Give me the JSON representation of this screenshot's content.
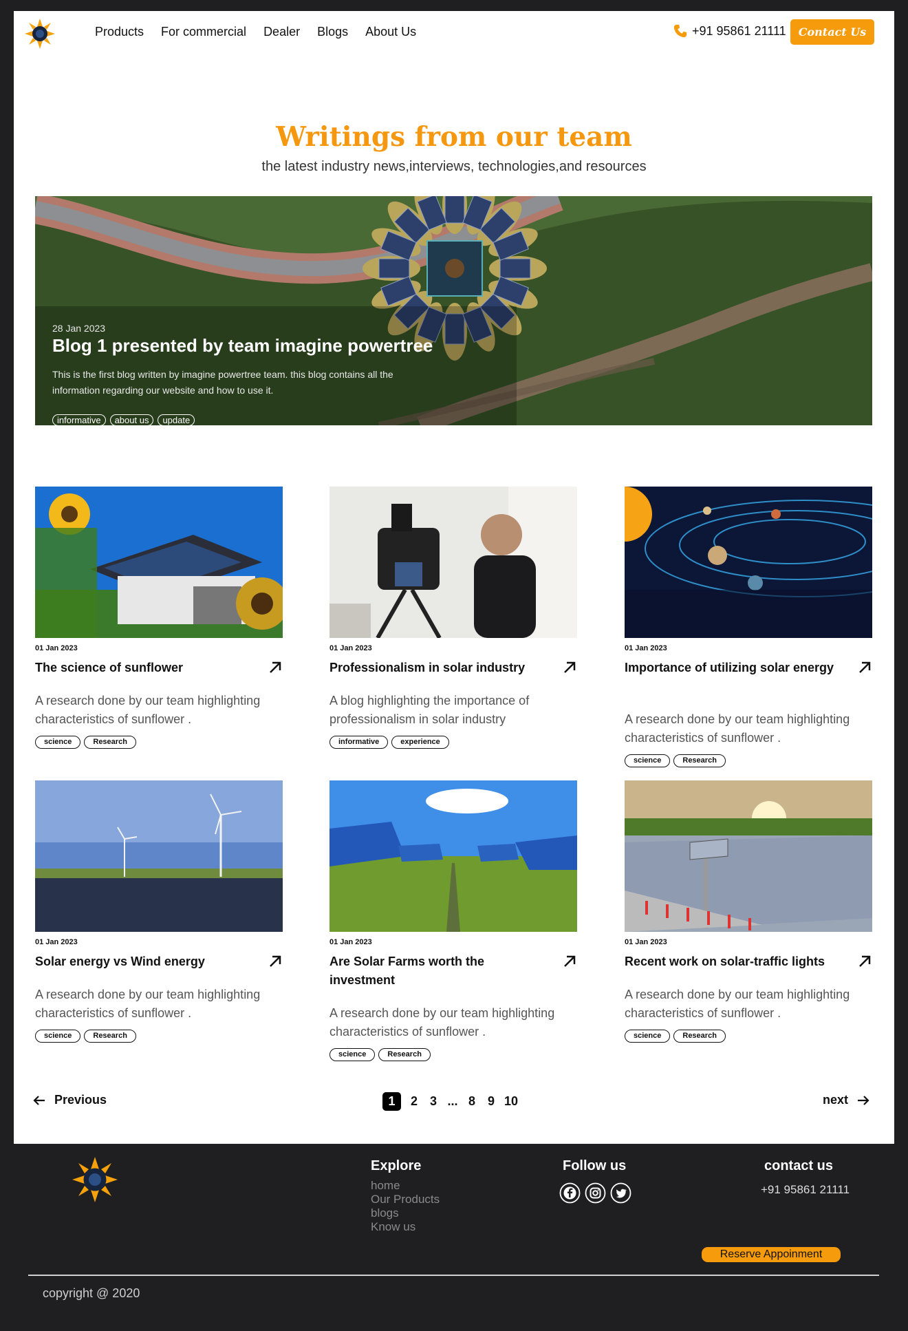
{
  "header": {
    "nav": [
      "Products",
      "For commercial",
      "Dealer",
      "Blogs",
      "About Us"
    ],
    "phone": "+91 95861 21111",
    "contact_label": "Contact Us"
  },
  "intro": {
    "title": "Writings from our team",
    "subtitle": "the latest industry news,interviews, technologies,and resources"
  },
  "featured": {
    "date": "28 Jan 2023",
    "title": "Blog 1 presented by team imagine powertree",
    "description": "This is the first blog written by imagine powertree team. this blog contains all the information regarding our website and how to use it.",
    "tags": [
      "informative",
      "about us",
      "update"
    ]
  },
  "posts": [
    {
      "date": "01 Jan 2023",
      "title": "The science of sunflower",
      "description": "A research done by our team highlighting characteristics of sunflower .",
      "tags": [
        "science",
        "Research"
      ]
    },
    {
      "date": "01 Jan 2023",
      "title": "Professionalism in solar industry",
      "description": "A blog highlighting the importance of professionalism in solar industry",
      "tags": [
        "informative",
        "experience"
      ]
    },
    {
      "date": "01 Jan 2023",
      "title": "Importance of utilizing solar energy",
      "description": "A research done by our team highlighting characteristics of sunflower .",
      "tags": [
        "science",
        "Research"
      ]
    },
    {
      "date": "01 Jan 2023",
      "title": "Solar energy vs Wind energy",
      "description": "A research done by our team highlighting characteristics of sunflower .",
      "tags": [
        "science",
        "Research"
      ]
    },
    {
      "date": "01 Jan 2023",
      "title": "Are Solar Farms worth the investment",
      "description": "A research done by our team highlighting characteristics of sunflower .",
      "tags": [
        "science",
        "Research"
      ]
    },
    {
      "date": "01 Jan 2023",
      "title": "Recent work on solar-traffic lights",
      "description": "A research done by our team highlighting characteristics of sunflower .",
      "tags": [
        "science",
        "Research"
      ]
    }
  ],
  "pagination": {
    "previous": "Previous",
    "next": "next",
    "pages": [
      "1",
      "2",
      "3",
      "...",
      "8",
      "9",
      "10"
    ],
    "current": "1"
  },
  "footer": {
    "explore_title": "Explore",
    "explore_links": [
      "home",
      "Our Products",
      "blogs",
      "Know us"
    ],
    "follow_title": "Follow us",
    "social_icons": [
      "facebook-icon",
      "instagram-icon",
      "twitter-icon"
    ],
    "contact_title": "contact us",
    "contact_phone": "+91 95861 21111",
    "reserve_label": "Reserve Appoinment",
    "copyright": "copyright @ 2020"
  },
  "colors": {
    "accent": "#f59b0c",
    "dark": "#1f1f21"
  }
}
